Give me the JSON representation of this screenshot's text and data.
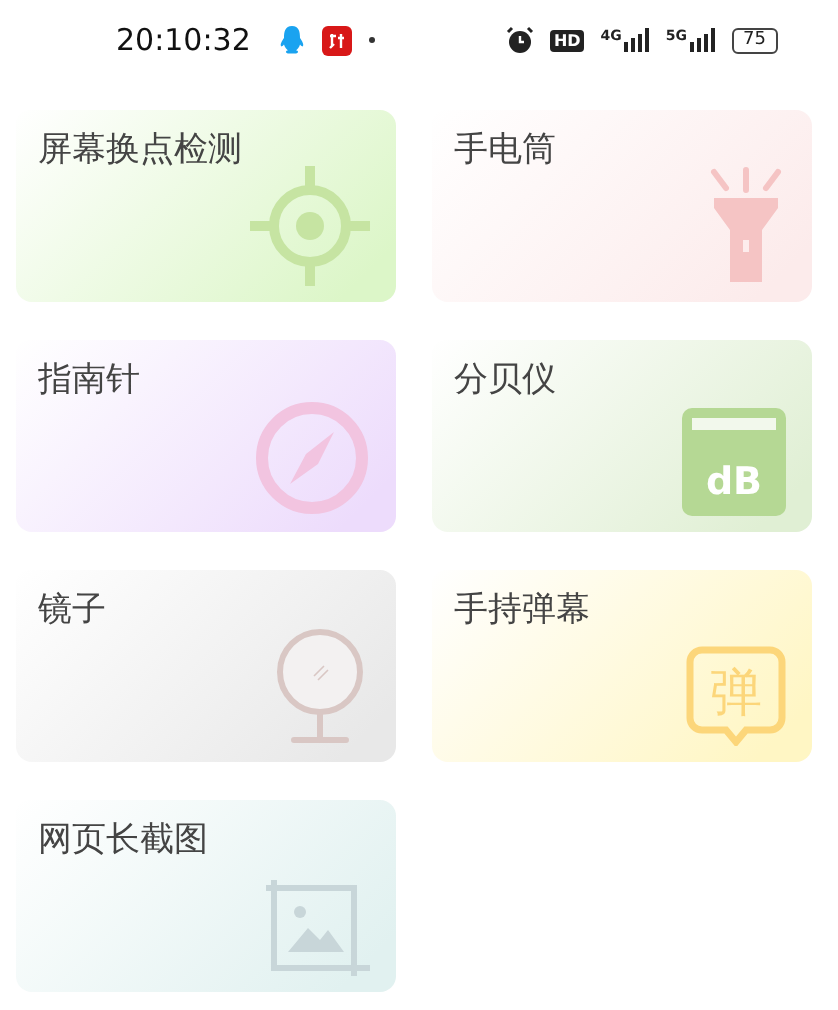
{
  "status_bar": {
    "time": "20:10:32",
    "hd": "HD",
    "net_1": "4G",
    "net_2": "5G",
    "battery": "75"
  },
  "tools": [
    {
      "title": "屏幕换点检测",
      "kind": "crosshair",
      "color": "#dcf6c8"
    },
    {
      "title": "手电筒",
      "kind": "flashlight",
      "color": "#fcebeb"
    },
    {
      "title": "指南针",
      "kind": "compass",
      "color": "#eddcfc"
    },
    {
      "title": "分贝仪",
      "kind": "decibel",
      "color": "#e0efd4",
      "icon_text": "dB"
    },
    {
      "title": "镜子",
      "kind": "mirror",
      "color": "#e8e8e8"
    },
    {
      "title": "手持弹幕",
      "kind": "danmaku",
      "color": "#fff6c4",
      "icon_text": "弹"
    },
    {
      "title": "网页长截图",
      "kind": "screenshot",
      "color": "#e1f1f0"
    }
  ]
}
